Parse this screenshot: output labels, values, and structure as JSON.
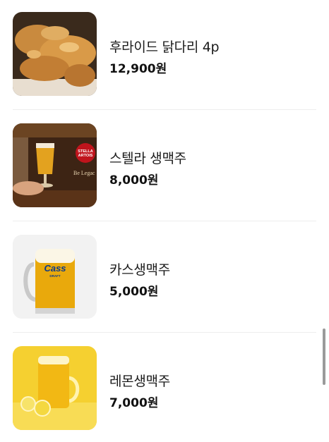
{
  "menu": {
    "items": [
      {
        "name": "후라이드 닭다리 4p",
        "price": "12,900원",
        "image": "fried-chicken-drumsticks"
      },
      {
        "name": "스텔라 생맥주",
        "price": "8,000원",
        "image": "stella-artois-draft-beer"
      },
      {
        "name": "카스생맥주",
        "price": "5,000원",
        "image": "cass-draft-beer-mug"
      },
      {
        "name": "레몬생맥주",
        "price": "7,000원",
        "image": "lemon-draft-beer-mug"
      }
    ]
  },
  "labels": {
    "stella_logo_line1": "STELLA",
    "stella_logo_line2": "ARTOIS",
    "stella_slogan": "Be Legac",
    "cass_logo": "Cass",
    "cass_sub": "DRAFT"
  },
  "colors": {
    "text": "#1a1a1a",
    "divider": "#ededed",
    "scrollbar": "#9a9a9a"
  }
}
